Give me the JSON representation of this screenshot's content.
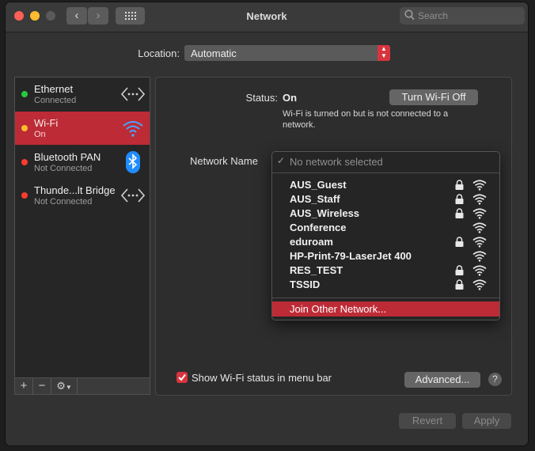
{
  "window": {
    "title": "Network"
  },
  "toolbar": {
    "back_label": "‹",
    "forward_label": "›",
    "search_placeholder": "Search"
  },
  "location": {
    "label": "Location:",
    "value": "Automatic"
  },
  "services": [
    {
      "name": "Ethernet",
      "status": "Connected",
      "dot_color": "#27c93f",
      "icon": "ethernet-icon"
    },
    {
      "name": "Wi-Fi",
      "status": "On",
      "dot_color": "#febc2e",
      "icon": "wifi-icon"
    },
    {
      "name": "Bluetooth PAN",
      "status": "Not Connected",
      "dot_color": "#fe3b30",
      "icon": "bluetooth-icon"
    },
    {
      "name": "Thunde...lt Bridge",
      "status": "Not Connected",
      "dot_color": "#fe3b30",
      "icon": "thunderbolt-bridge-icon"
    }
  ],
  "sidebar_actions": {
    "add": "+",
    "remove": "−",
    "gear": "⚙"
  },
  "status": {
    "label": "Status:",
    "value": "On",
    "description": "Wi-Fi is turned on but is not connected to a network.",
    "toggle_button": "Turn Wi-Fi Off"
  },
  "network_name": {
    "label": "Network Name",
    "selected": "No network selected",
    "networks": [
      {
        "name": "AUS_Guest",
        "locked": true
      },
      {
        "name": "AUS_Staff",
        "locked": true
      },
      {
        "name": "AUS_Wireless",
        "locked": true
      },
      {
        "name": "Conference",
        "locked": false
      },
      {
        "name": "eduroam",
        "locked": true
      },
      {
        "name": "HP-Print-79-LaserJet 400",
        "locked": false
      },
      {
        "name": "RES_TEST",
        "locked": true
      },
      {
        "name": "TSSID",
        "locked": true
      }
    ],
    "join_other": "Join Other Network..."
  },
  "footer": {
    "show_status_label": "Show Wi-Fi status in menu bar",
    "show_status_checked": true,
    "advanced": "Advanced...",
    "help": "?",
    "revert": "Revert",
    "apply": "Apply"
  },
  "colors": {
    "accent": "#bd2b36",
    "checkbox": "#d8343e"
  }
}
